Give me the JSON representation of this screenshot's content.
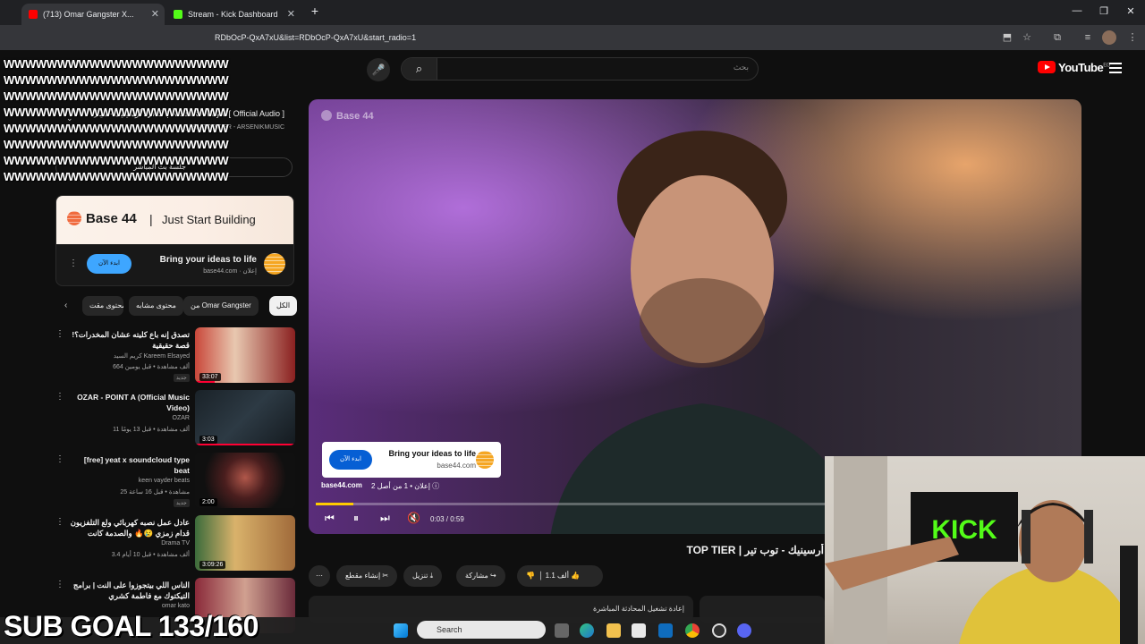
{
  "browser": {
    "tabs": [
      {
        "label": "(713) Omar Gangster X...",
        "active": true
      },
      {
        "label": "Stream - Kick Dashboard",
        "active": false
      }
    ],
    "new_tab": "+",
    "url": "youtube.com/watch?v=...xU&list=RDbOcP-QxA7xU&start_radio=1",
    "url_visible": "RDbOcP-QxA7xU&list=RDbOcP-QxA7xU&start_radio=1",
    "window_controls": {
      "minimize": "—",
      "restore": "❐",
      "close": "✕"
    }
  },
  "header": {
    "logo": "YouTube",
    "region": "EG",
    "search_placeholder": "بحث"
  },
  "overlay": {
    "spam_lines": [
      "WWWWWWWWWWWWWWWWWWWWW",
      "WWWWWWWWWWWWWWWWWWWWW",
      "WWWWWWWWWWWWWWWWWWWWW",
      "WWWWWWWWWWWWWWWWWWWWW",
      "WWWWWWWWWWWWWWWWWWWWW",
      "WWWWWWWWWWWWWWWWWWWWW",
      "WWWWWWWWWWWWWWWWWWWWW",
      "WWWWWWWWWWWWWWWWWWWWW"
    ],
    "sub_goal": "SUB GOAL 133/160"
  },
  "playlist": {
    "now_playing": "التالي: أرسينيك - ميال | Arsenik - Mayal [ Official Audio ]",
    "sub": "ميكس TOP TIER - ARSENIKMUSIC",
    "mix_label": "جلسة بث المباشر"
  },
  "sidebar_ad": {
    "brand": "Base 44",
    "separator": "|",
    "tagline": "Just Start Building",
    "headline": "Bring your ideas to life",
    "domain": "base44.com · إعلان",
    "cta": "ابدء الآن"
  },
  "chips": [
    {
      "label": "الكل",
      "selected": true
    },
    {
      "label": "من Omar Gangster",
      "selected": false
    },
    {
      "label": "محتوى مشابه",
      "selected": false
    },
    {
      "label": "محتوى مقت",
      "selected": false
    }
  ],
  "recommendations": [
    {
      "title": "تصدق إنه باع كليته عشان المخدرات؟! قصة حقيقية",
      "channel": "كريم السيد Kareem Elsayed",
      "meta": "664 ألف مشاهدة • قبل يومين",
      "badge": "جديد",
      "duration": "33:07"
    },
    {
      "title": "OZAR - POINT A (Official Music Video)",
      "channel": "OZAR",
      "meta": "11 ألف مشاهدة • قبل 13 يومًا",
      "badge": "",
      "duration": "3:03"
    },
    {
      "title": "[free] yeat x soundcloud type beat",
      "channel": "keen vayder beats",
      "meta": "25 مشاهدة • قبل 16 ساعة",
      "badge": "جديد",
      "duration": "2:00"
    },
    {
      "title": "عادل عمل نصبه كهربائي ولع التلفزيون قدام زمزي 😢🔥 والصدمة كانت عالمية ...",
      "channel": "Drama TV",
      "meta": "3.4 ألف مشاهدة • قبل 10 أيام",
      "badge": "",
      "duration": "3:09:26"
    },
    {
      "title": "الناس اللي بيتجوزوا على النت | برامج التيكتوك مع فاطمة كشري",
      "channel": "omar kato",
      "meta": "",
      "badge": "",
      "duration": ""
    }
  ],
  "video": {
    "watermark": "Base 44",
    "ad_card_headline": "Bring your ideas to life",
    "ad_card_domain": "base44.com",
    "ad_card_cta": "ابدء الآن",
    "ad_domain": "base44.com",
    "ad_info": "إعلان • 1 من أصل 2 ⓘ",
    "time": "0:03 / 0:59",
    "progress": 0.05
  },
  "below": {
    "title": "أرسينيك - توب تير | TOP TIER -",
    "likes": "1.1 ألف",
    "share": "مشاركة",
    "download": "تنزيل",
    "clip": "إنشاء مقطع",
    "more": "⋯",
    "replay_chat": "إعادة تشغيل المحادثة المباشرة"
  },
  "webcam": {
    "flag_text": "KICK"
  },
  "taskbar": {
    "search": "Search"
  }
}
